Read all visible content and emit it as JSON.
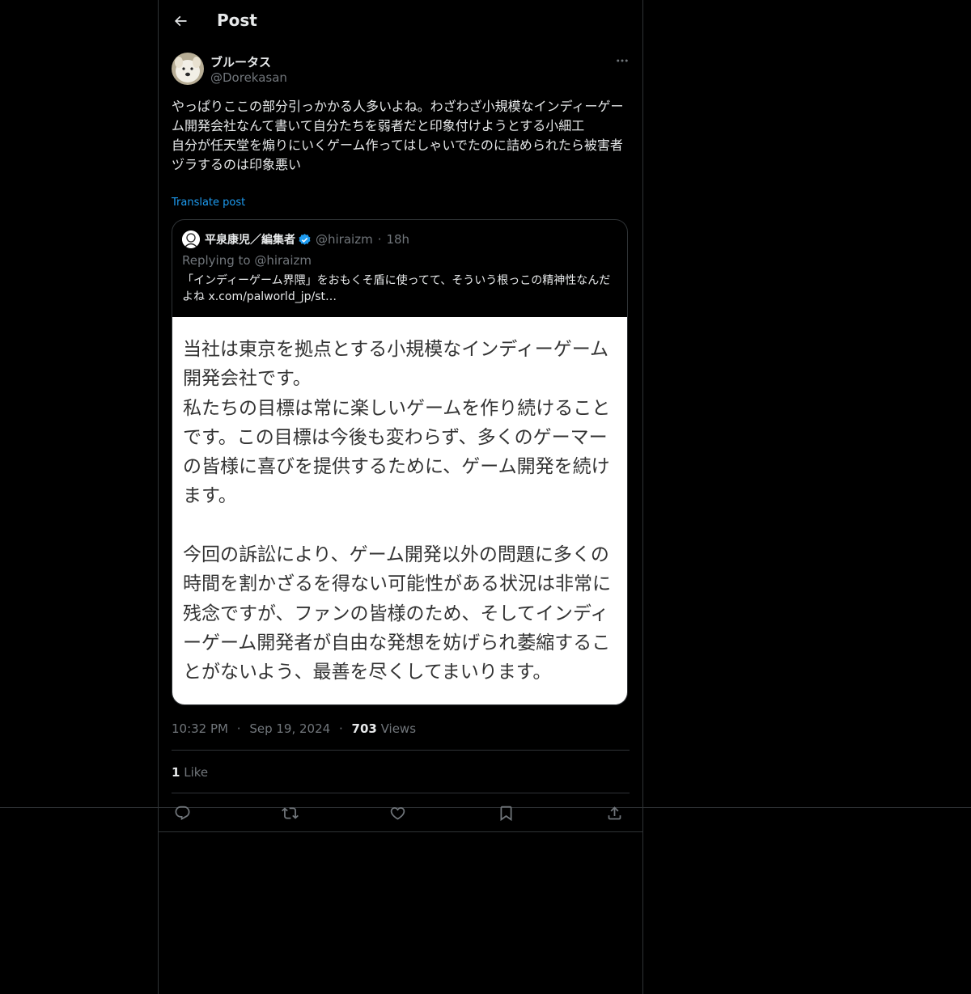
{
  "header": {
    "title": "Post"
  },
  "post": {
    "author_name": "ブルータス",
    "author_handle": "@Dorekasan",
    "text": "やっぱりここの部分引っかかる人多いよね。わざわざ小規模なインディーゲーム開発会社なんて書いて自分たちを弱者だと印象付けようとする小細工\n自分が任天堂を煽りにいくゲーム作ってはしゃいでたのに詰められたら被害者ヅラするのは印象悪い",
    "translate_label": "Translate post",
    "time": "10:32 PM",
    "date": "Sep 19, 2024",
    "views_count": "703",
    "views_label": "Views",
    "likes_count": "1",
    "likes_label": "Like"
  },
  "quote": {
    "author_name": "平泉康児／編集者",
    "author_handle": "@hiraizm",
    "time_ago": "18h",
    "separator": "·",
    "replying_to": "Replying to @hiraizm",
    "text": "「インディーゲーム界隈」をおもくそ盾に使ってて、そういう根っこの精神性なんだよね  x.com/palworld_jp/st…",
    "image_text": "当社は東京を拠点とする小規模なインディーゲーム\n開発会社です。\n私たちの目標は常に楽しいゲームを作り続けること\nです。この目標は今後も変わらず、多くのゲーマー\nの皆様に喜びを提供するために、ゲーム開発を続け\nます。\n\n今回の訴訟により、ゲーム開発以外の問題に多くの\n時間を割かざるを得ない可能性がある状況は非常に\n残念ですが、ファンの皆様のため、そしてインディ\nーゲーム開発者が自由な発想を妨げられ萎縮するこ\nとがないよう、最善を尽くしてまいります。",
    "verified_color": "#1d9bf0"
  },
  "meta_separator": "·",
  "icons": {
    "back": "arrow-left-icon",
    "more": "more-horizontal-icon",
    "reply": "reply-icon",
    "retweet": "retweet-icon",
    "like": "heart-icon",
    "bookmark": "bookmark-icon",
    "share": "share-icon",
    "verified": "verified-badge-icon"
  },
  "colors": {
    "accent": "#1d9bf0",
    "text": "#e7e9ea",
    "muted": "#71767b",
    "border": "#2f3336",
    "background": "#000000"
  }
}
